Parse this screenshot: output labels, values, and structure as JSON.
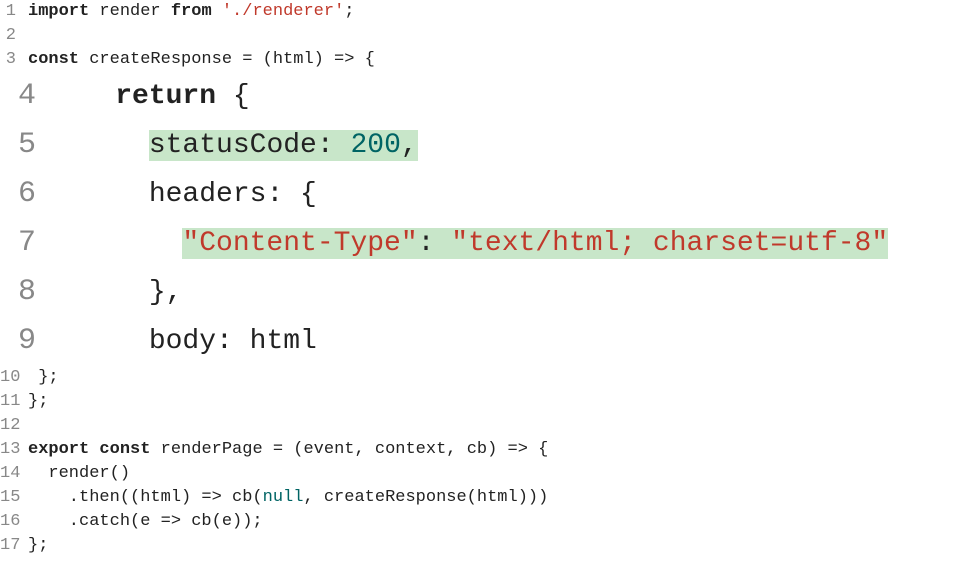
{
  "lines": {
    "l1": {
      "no": "1"
    },
    "l2": {
      "no": "2"
    },
    "l3": {
      "no": "3"
    },
    "l4": {
      "no": "4"
    },
    "l5": {
      "no": "5"
    },
    "l6": {
      "no": "6"
    },
    "l7": {
      "no": "7"
    },
    "l8": {
      "no": "8"
    },
    "l9": {
      "no": "9"
    },
    "l10": {
      "no": "10"
    },
    "l11": {
      "no": "11"
    },
    "l12": {
      "no": "12"
    },
    "l13": {
      "no": "13"
    },
    "l14": {
      "no": "14"
    },
    "l15": {
      "no": "15"
    },
    "l16": {
      "no": "16"
    },
    "l17": {
      "no": "17"
    }
  },
  "tokens": {
    "import": "import",
    "render": " render ",
    "from": "from",
    "renderer_path": " './renderer'",
    "semi": ";",
    "const": "const",
    "createResponse_decl": " createResponse = (html) => {",
    "return": "return",
    "brace_open_space": " {",
    "statusCode_label": "statusCode: ",
    "statusCode_value": "200",
    "comma": ",",
    "headers_label": "headers: {",
    "content_type_key": "\"Content-Type\"",
    "colon_space": ": ",
    "content_type_value": "\"text/html; charset=utf-8\"",
    "brace_close_comma": "},",
    "body_label": "body: html",
    "brace_close_semi_1": " };",
    "brace_close_semi_2": "};",
    "export": "export",
    "space": " ",
    "renderPage_decl": " renderPage = (event, context, cb) => {",
    "render_call": "  render()",
    "then_pre": "    .then((html) => cb(",
    "null": "null",
    "then_post": ", createResponse(html)))",
    "catch_line": "    .catch(e => cb(e));",
    "indent4": "    ",
    "indent6": "      ",
    "indent8": "        "
  }
}
